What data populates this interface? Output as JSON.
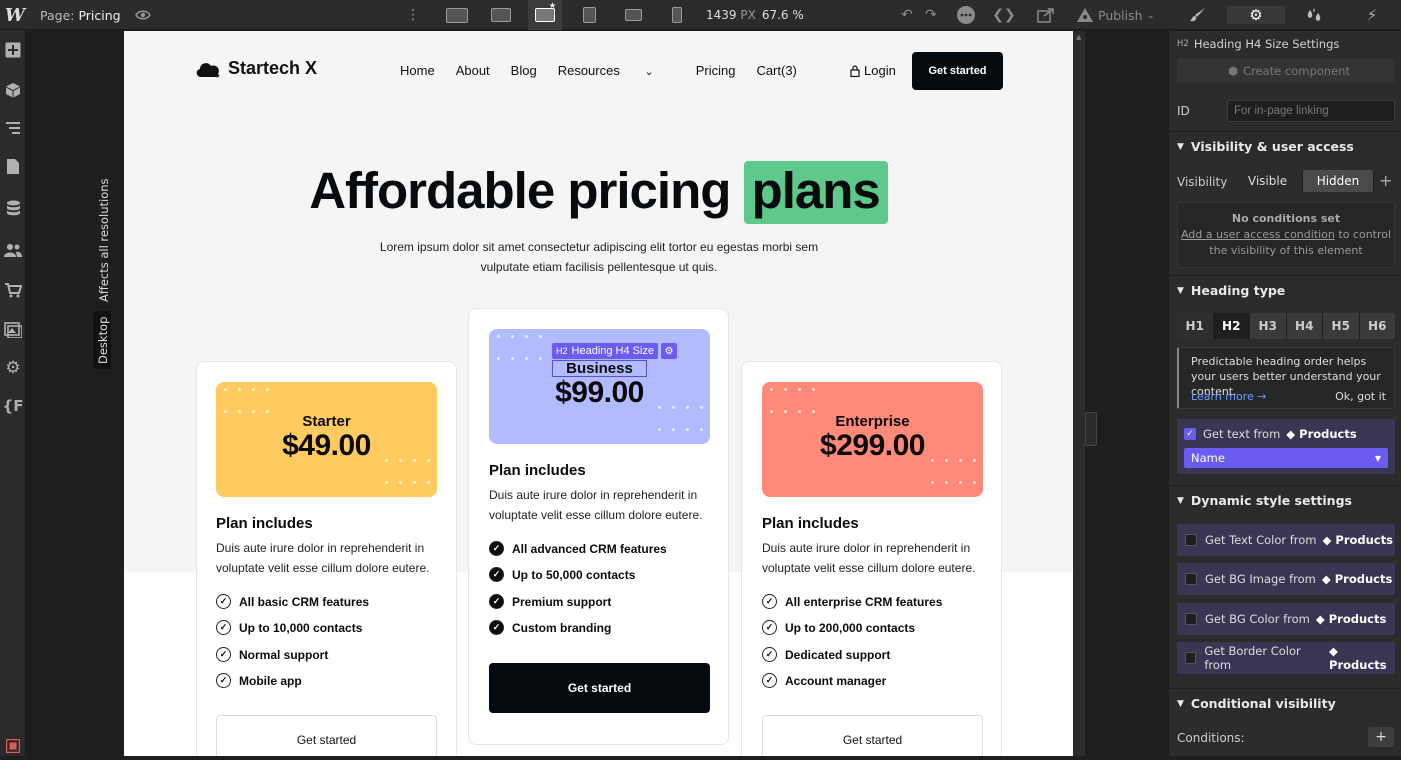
{
  "topbar": {
    "logo": "W",
    "page_prefix": "Page:",
    "page_name": "Pricing",
    "width_value": "1439",
    "width_unit": "PX",
    "zoom": "67.6 %",
    "publish": "Publish"
  },
  "canvas": {
    "affects_label": "Affects all resolutions",
    "breakpoint_label": "Desktop"
  },
  "site": {
    "brand": "Startech X",
    "nav": [
      "Home",
      "About",
      "Blog",
      "Resources",
      "Pricing",
      "Cart(3)"
    ],
    "login": "Login",
    "cta": "Get started",
    "hero_main": "Affordable pricing",
    "hero_highlight": "plans",
    "hero_highlight_color": "#5ec98a",
    "subtitle": "Lorem ipsum dolor sit amet consectetur adipiscing elit tortor eu egestas morbi sem vulputate etiam facilisis pellentesque ut quis.",
    "plans": [
      {
        "name": "Starter",
        "price": "$49.00",
        "color": "#ffcb60",
        "includes_title": "Plan includes",
        "includes_desc": "Duis aute irure dolor in reprehenderit in voluptate velit esse cillum dolore eutere.",
        "features": [
          "All basic CRM features",
          "Up to 10,000 contacts",
          "Normal support",
          "Mobile app"
        ],
        "button": "Get started"
      },
      {
        "name": "Business",
        "price": "$99.00",
        "color": "#b3bbff",
        "includes_title": "Plan includes",
        "includes_desc": "Duis aute irure dolor in reprehenderit in voluptate velit esse cillum dolore eutere.",
        "features": [
          "All advanced CRM features",
          "Up to 50,000 contacts",
          "Premium support",
          "Custom branding"
        ],
        "button": "Get started"
      },
      {
        "name": "Enterprise",
        "price": "$299.00",
        "color": "#ff8a7a",
        "includes_title": "Plan includes",
        "includes_desc": "Duis aute irure dolor in reprehenderit in voluptate velit esse cillum dolore eutere.",
        "features": [
          "All enterprise CRM features",
          "Up to 200,000 contacts",
          "Dedicated support",
          "Account manager"
        ],
        "button": "Get started"
      }
    ],
    "selection_tag": "Heading H4 Size",
    "selection_level": "H2"
  },
  "panel": {
    "header_level": "H2",
    "header_title": "Heading H4 Size Settings",
    "create_component": "Create component",
    "id_label": "ID",
    "id_placeholder": "For in-page linking",
    "visibility_section": "Visibility & user access",
    "visibility_label": "Visibility",
    "visible": "Visible",
    "hidden": "Hidden",
    "no_conditions": "No conditions set",
    "add_condition_link": "Add a user access condition",
    "add_condition_rest": "to control the visibility of this element",
    "heading_type_section": "Heading type",
    "heading_levels": [
      "H1",
      "H2",
      "H3",
      "H4",
      "H5",
      "H6"
    ],
    "heading_tip": "Predictable heading order helps your users better understand your content.",
    "learn_more": "Learn more →",
    "ok_got_it": "Ok, got it",
    "get_text_from": "Get text from",
    "products": "Products",
    "name_field": "Name",
    "dynamic_section": "Dynamic style settings",
    "dynamic_rows": [
      "Get Text Color from",
      "Get BG Image from",
      "Get BG Color from",
      "Get Border Color from"
    ],
    "conditional_section": "Conditional visibility",
    "conditions_label": "Conditions:"
  }
}
